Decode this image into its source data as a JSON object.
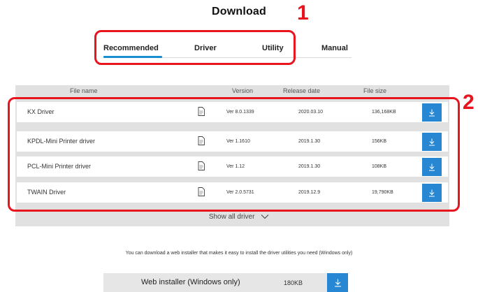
{
  "page": {
    "title": "Download"
  },
  "tabs": [
    {
      "label": "Recommended",
      "selected": true
    },
    {
      "label": "Driver",
      "selected": false
    },
    {
      "label": "Utility",
      "selected": false
    },
    {
      "label": "Manual",
      "selected": false
    }
  ],
  "annotations": {
    "tabs_number": "1",
    "rows_number": "2",
    "color": "#e8141e"
  },
  "table": {
    "headers": {
      "filename": "File name",
      "version": "Version",
      "release_date": "Release date",
      "file_size": "File size"
    },
    "rows": [
      {
        "name": "KX Driver",
        "version": "Ver 8.0.1339",
        "date": "2020.03.10",
        "size": "136,168KB"
      },
      {
        "name": "KPDL-Mini Printer driver",
        "version": "Ver 1.1610",
        "date": "2019.1.30",
        "size": "156KB"
      },
      {
        "name": "PCL-Mini Printer driver",
        "version": "Ver 1.12",
        "date": "2019.1.30",
        "size": "108KB"
      },
      {
        "name": "TWAIN Driver",
        "version": "Ver 2.0.5731",
        "date": "2019.12.9",
        "size": "19,790KB"
      }
    ],
    "show_all_label": "Show all driver"
  },
  "installer": {
    "note": "You can download a web installer that makes it easy to install the driver utilities you need (Windows only)",
    "label": "Web installer (Windows only)",
    "size": "180KB"
  },
  "colors": {
    "accent": "#2787d2",
    "tab_underline": "#1a8fd0",
    "panel": "#e1e1e1"
  }
}
